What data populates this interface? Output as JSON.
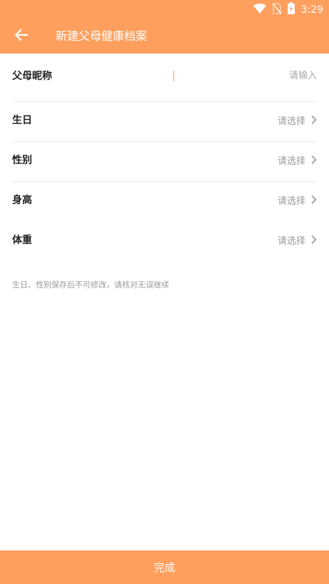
{
  "status_bar": {
    "time": "3:29",
    "icons": [
      "wifi-icon",
      "no-sim-icon",
      "battery-charging-icon"
    ]
  },
  "header": {
    "title": "新建父母健康档案",
    "back_icon": "arrow-left-icon"
  },
  "form": {
    "nickname": {
      "label": "父母昵称",
      "value": "",
      "placeholder": "请输入"
    },
    "birthday": {
      "label": "生日",
      "value": "请选择"
    },
    "gender": {
      "label": "性别",
      "value": "请选择"
    },
    "height": {
      "label": "身高",
      "value": "请选择"
    },
    "weight": {
      "label": "体重",
      "value": "请选择"
    }
  },
  "hint": "生日、性别保存后不可修改，请核对无误继续",
  "footer": {
    "submit_label": "完成"
  },
  "colors": {
    "accent": "#FF9F5E",
    "label": "#222222",
    "muted": "#9A9A9A",
    "divider": "#ECECEC"
  }
}
